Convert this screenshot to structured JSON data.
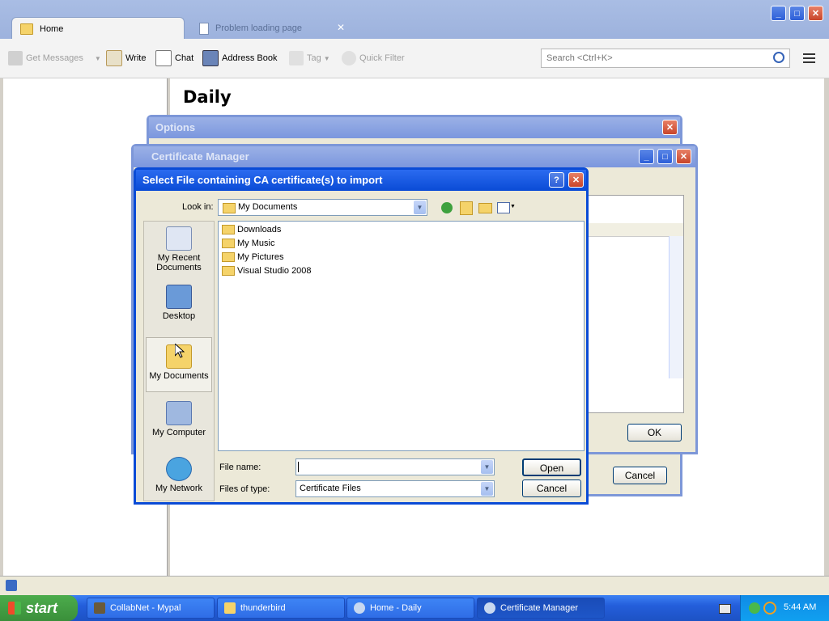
{
  "thunderbird": {
    "tabs": [
      {
        "label": "Home"
      },
      {
        "label": "Problem loading page",
        "close": "✕"
      }
    ],
    "toolbar": {
      "get_messages": "Get Messages",
      "write": "Write",
      "chat": "Chat",
      "address_book": "Address Book",
      "tag": "Tag",
      "quick_filter": "Quick Filter",
      "search_placeholder": "Search <Ctrl+K>"
    },
    "content_heading": "Daily"
  },
  "options_window": {
    "title": "Options"
  },
  "cert_manager": {
    "title": "Certificate Manager",
    "ok": "OK",
    "cancel": "Cancel"
  },
  "file_dialog": {
    "title": "Select File containing CA certificate(s) to import",
    "look_in_label": "Look in:",
    "look_in_value": "My Documents",
    "places": [
      {
        "label": "My Recent Documents"
      },
      {
        "label": "Desktop"
      },
      {
        "label": "My Documents"
      },
      {
        "label": "My Computer"
      },
      {
        "label": "My Network"
      }
    ],
    "files": [
      {
        "name": "Downloads"
      },
      {
        "name": "My Music"
      },
      {
        "name": "My Pictures"
      },
      {
        "name": "Visual Studio 2008"
      }
    ],
    "file_name_label": "File name:",
    "file_name_value": "",
    "files_of_type_label": "Files of type:",
    "files_of_type_value": "Certificate Files",
    "open": "Open",
    "cancel": "Cancel"
  },
  "taskbar": {
    "start": "start",
    "tasks": [
      {
        "label": "CollabNet - Mypal"
      },
      {
        "label": "thunderbird"
      },
      {
        "label": "Home - Daily"
      },
      {
        "label": "Certificate Manager"
      }
    ],
    "clock": "5:44 AM"
  },
  "colors": {
    "xp_blue": "#0a4bd6",
    "taskbar": "#245edb",
    "start_green": "#3a8f3a"
  }
}
